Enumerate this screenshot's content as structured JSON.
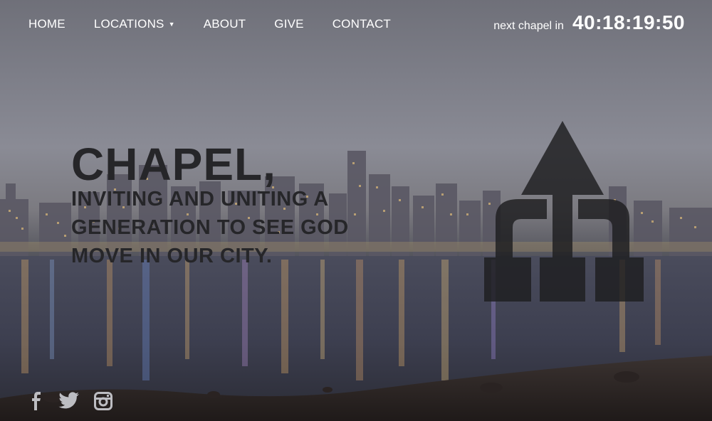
{
  "nav": {
    "items": [
      {
        "label": "HOME"
      },
      {
        "label": "LOCATIONS",
        "caret": "▼"
      },
      {
        "label": "ABOUT"
      },
      {
        "label": "GIVE"
      },
      {
        "label": "CONTACT"
      }
    ]
  },
  "countdown": {
    "label": "next chapel in",
    "time": "40:18:19:50"
  },
  "hero": {
    "title": "CHAPEL,",
    "subtitle": "INVITING AND UNITING A GENERATION TO SEE GOD MOVE IN OUR CITY."
  },
  "logo": {
    "icon": "chapel-arrow-logo-icon",
    "color": "#1e1e20"
  },
  "social": [
    {
      "icon": "facebook-icon"
    },
    {
      "icon": "twitter-icon"
    },
    {
      "icon": "instagram-icon"
    }
  ],
  "colors": {
    "nav_text": "#ffffff",
    "hero_text": "#262629",
    "icon_color": "#bdbdc2"
  }
}
